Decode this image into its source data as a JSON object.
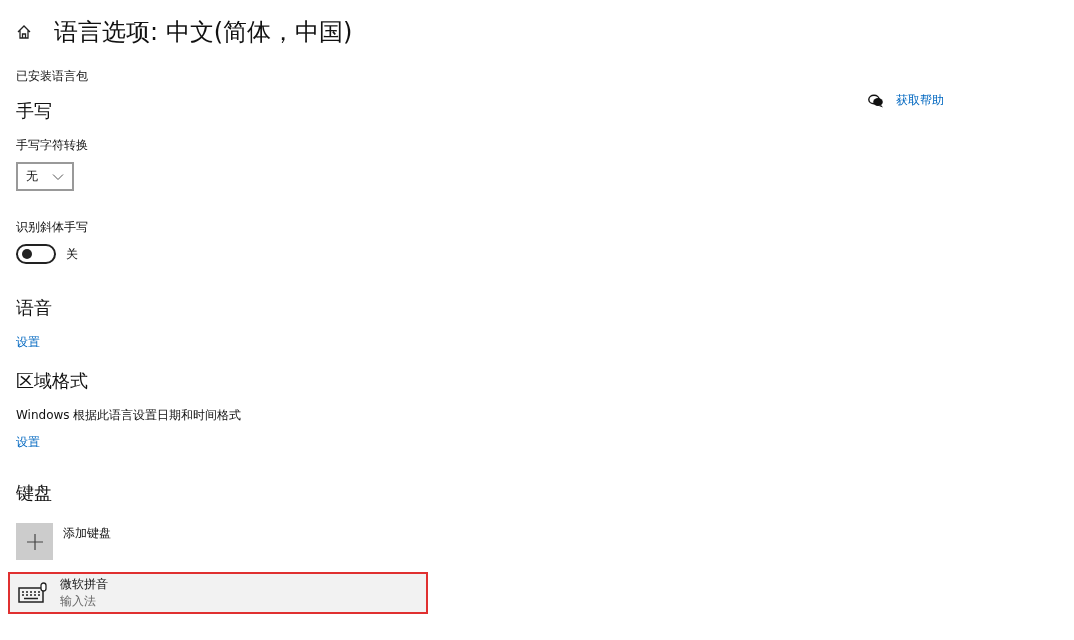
{
  "page": {
    "title": "语言选项: 中文(简体，中国)"
  },
  "help_link": {
    "label": "获取帮助"
  },
  "language_pack": {
    "label": "已安装语言包"
  },
  "handwriting": {
    "heading": "手写",
    "conversion": {
      "label": "手写字符转换",
      "value": "无"
    },
    "cursive": {
      "label": "识别斜体手写",
      "on": false,
      "state_label": "关"
    }
  },
  "speech": {
    "heading": "语音",
    "link": "设置"
  },
  "region": {
    "heading": "区域格式",
    "description": "Windows 根据此语言设置日期和时间格式",
    "link": "设置"
  },
  "keyboard": {
    "heading": "键盘",
    "add_label": "添加键盘",
    "items": [
      {
        "name": "微软拼音",
        "subtitle": "输入法",
        "selected": true
      }
    ]
  }
}
